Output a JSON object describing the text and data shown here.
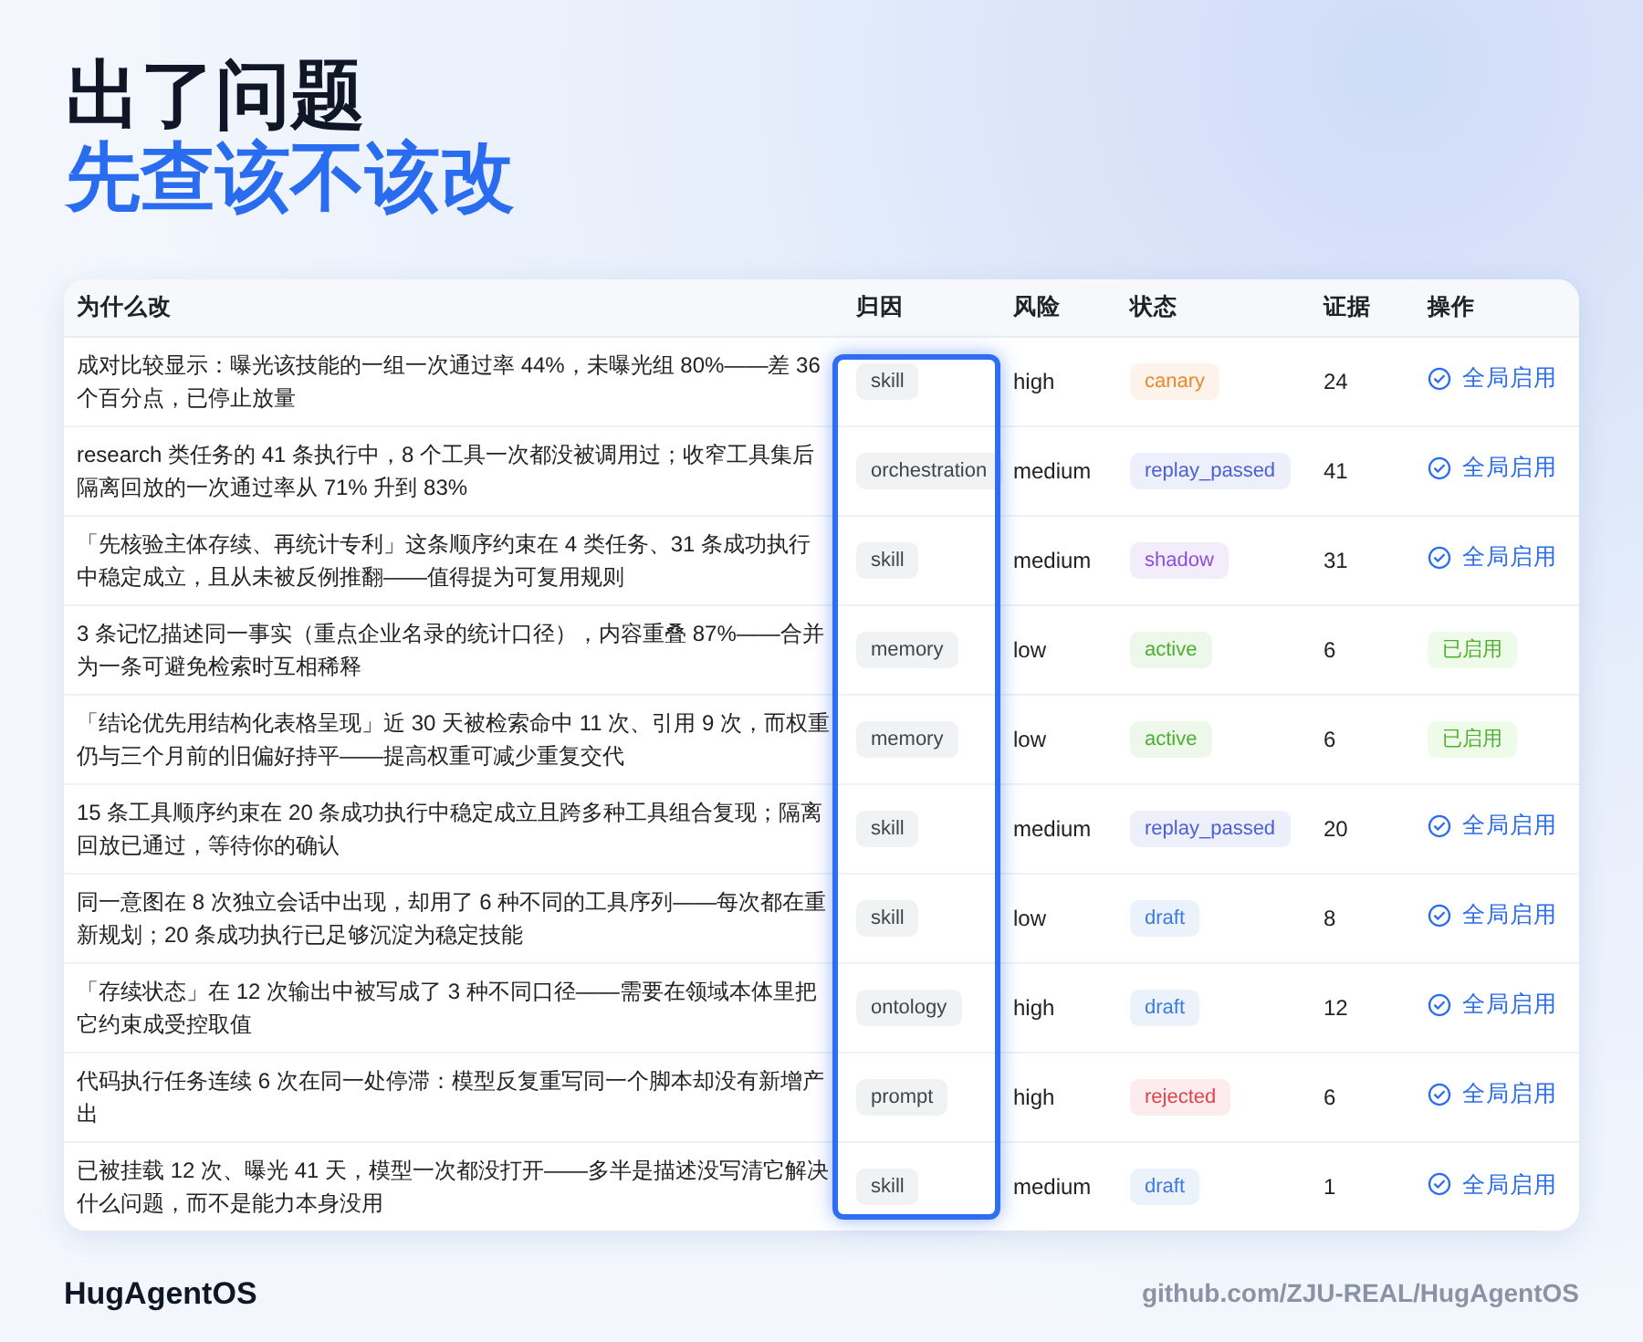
{
  "title": {
    "line_1": "出了问题",
    "line_2": "先查该不该改"
  },
  "table": {
    "columns": [
      {
        "label": "为什么改",
        "highlighted": false
      },
      {
        "label": "归因",
        "highlighted": true
      },
      {
        "label": "风险",
        "highlighted": false
      },
      {
        "label": "状态",
        "highlighted": false
      },
      {
        "label": "证据",
        "highlighted": false
      },
      {
        "label": "操作",
        "highlighted": false
      }
    ],
    "rows": [
      {
        "reason": "成对比较显示：曝光该技能的一组一次通过率 44%，未曝光组 80%——差 36 个百分点，已停止放量",
        "attribution": "skill",
        "risk": "high",
        "status": {
          "text": "canary",
          "color": "#e8892b"
        },
        "evidence": "24",
        "action": {
          "kind": "button",
          "text": "全局启用"
        }
      },
      {
        "reason": "research 类任务的 41 条执行中，8 个工具一次都没被调用过；收窄工具集后隔离回放的一次通过率从 71% 升到 83%",
        "attribution": "orchestration",
        "risk": "medium",
        "status": {
          "text": "replay_passed",
          "color": "#4a5fd6"
        },
        "evidence": "41",
        "action": {
          "kind": "button",
          "text": "全局启用"
        }
      },
      {
        "reason": "「先核验主体存续、再统计专利」这条顺序约束在 4 类任务、31 条成功执行中稳定成立，且从未被反例推翻——值得提为可复用规则",
        "attribution": "skill",
        "risk": "medium",
        "status": {
          "text": "shadow",
          "color": "#8a4fd6"
        },
        "evidence": "31",
        "action": {
          "kind": "button",
          "text": "全局启用"
        }
      },
      {
        "reason": "3 条记忆描述同一事实（重点企业名录的统计口径），内容重叠 87%——合并为一条可避免检索时互相稀释",
        "attribution": "memory",
        "risk": "low",
        "status": {
          "text": "active",
          "color": "#4caf30"
        },
        "evidence": "6",
        "action": {
          "kind": "badge",
          "text": "已启用"
        }
      },
      {
        "reason": "「结论优先用结构化表格呈现」近 30 天被检索命中 11 次、引用 9 次，而权重仍与三个月前的旧偏好持平——提高权重可减少重复交代",
        "attribution": "memory",
        "risk": "low",
        "status": {
          "text": "active",
          "color": "#4caf30"
        },
        "evidence": "6",
        "action": {
          "kind": "badge",
          "text": "已启用"
        }
      },
      {
        "reason": "15 条工具顺序约束在 20 条成功执行中稳定成立且跨多种工具组合复现；隔离回放已通过，等待你的确认",
        "attribution": "skill",
        "risk": "medium",
        "status": {
          "text": "replay_passed",
          "color": "#4a5fd6"
        },
        "evidence": "20",
        "action": {
          "kind": "button",
          "text": "全局启用"
        }
      },
      {
        "reason": "同一意图在 8 次独立会话中出现，却用了 6 种不同的工具序列——每次都在重新规划；20 条成功执行已足够沉淀为稳定技能",
        "attribution": "skill",
        "risk": "low",
        "status": {
          "text": "draft",
          "color": "#3a7be0"
        },
        "evidence": "8",
        "action": {
          "kind": "button",
          "text": "全局启用"
        }
      },
      {
        "reason": "「存续状态」在 12 次输出中被写成了 3 种不同口径——需要在领域本体里把它约束成受控取值",
        "attribution": "ontology",
        "risk": "high",
        "status": {
          "text": "draft",
          "color": "#3a7be0"
        },
        "evidence": "12",
        "action": {
          "kind": "button",
          "text": "全局启用"
        }
      },
      {
        "reason": "代码执行任务连续 6 次在同一处停滞：模型反复重写同一个脚本却没有新增产出",
        "attribution": "prompt",
        "risk": "high",
        "status": {
          "text": "rejected",
          "color": "#e0444a"
        },
        "evidence": "6",
        "action": {
          "kind": "button",
          "text": "全局启用"
        }
      },
      {
        "reason": "已被挂载 12 次、曝光 41 天，模型一次都没打开——多半是描述没写清它解决什么问题，而不是能力本身没用",
        "attribution": "skill",
        "risk": "medium",
        "status": {
          "text": "draft",
          "color": "#3a7be0"
        },
        "evidence": "1",
        "action": {
          "kind": "button",
          "text": "全局启用"
        }
      }
    ]
  },
  "footer": {
    "brand": "Hug**Agent**OS",
    "link": "github.com/ZJU-REAL/HugAgentOS"
  }
}
